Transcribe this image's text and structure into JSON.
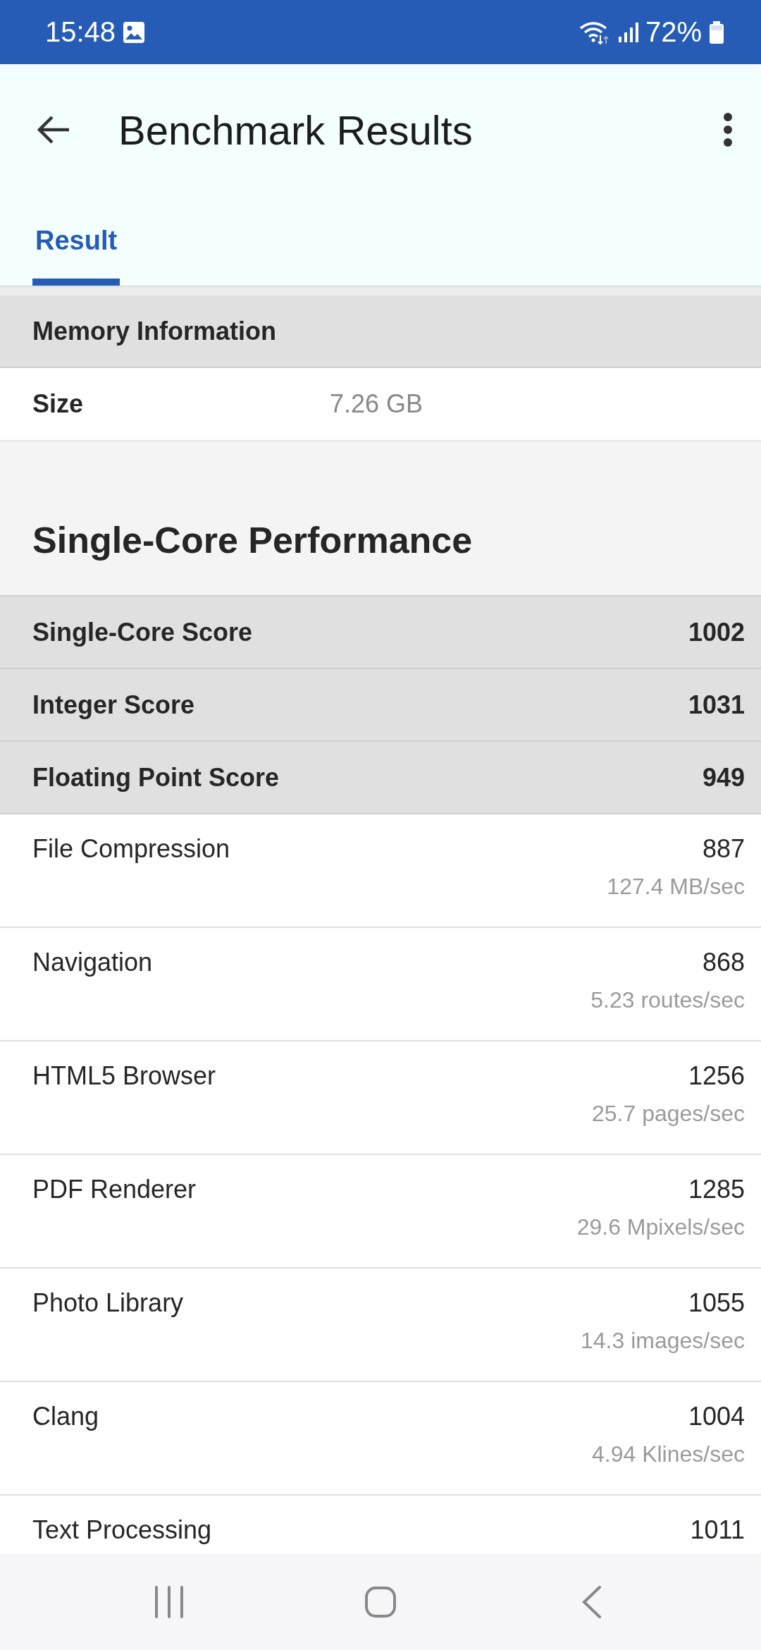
{
  "status_bar": {
    "time": "15:48",
    "battery": "72%"
  },
  "app_bar": {
    "title": "Benchmark Results"
  },
  "tabs": [
    {
      "label": "Result",
      "selected": true
    }
  ],
  "memory": {
    "header": "Memory Information",
    "rows": [
      {
        "label": "Size",
        "value": "7.26 GB"
      }
    ]
  },
  "single_core": {
    "title": "Single-Core Performance",
    "scores": [
      {
        "label": "Single-Core Score",
        "value": "1002"
      },
      {
        "label": "Integer Score",
        "value": "1031"
      },
      {
        "label": "Floating Point Score",
        "value": "949"
      }
    ],
    "tests": [
      {
        "name": "File Compression",
        "score": "887",
        "rate": "127.4 MB/sec"
      },
      {
        "name": "Navigation",
        "score": "868",
        "rate": "5.23 routes/sec"
      },
      {
        "name": "HTML5 Browser",
        "score": "1256",
        "rate": "25.7 pages/sec"
      },
      {
        "name": "PDF Renderer",
        "score": "1285",
        "rate": "29.6 Mpixels/sec"
      },
      {
        "name": "Photo Library",
        "score": "1055",
        "rate": "14.3 images/sec"
      },
      {
        "name": "Clang",
        "score": "1004",
        "rate": "4.94 Klines/sec"
      },
      {
        "name": "Text Processing",
        "score": "1011"
      }
    ]
  }
}
